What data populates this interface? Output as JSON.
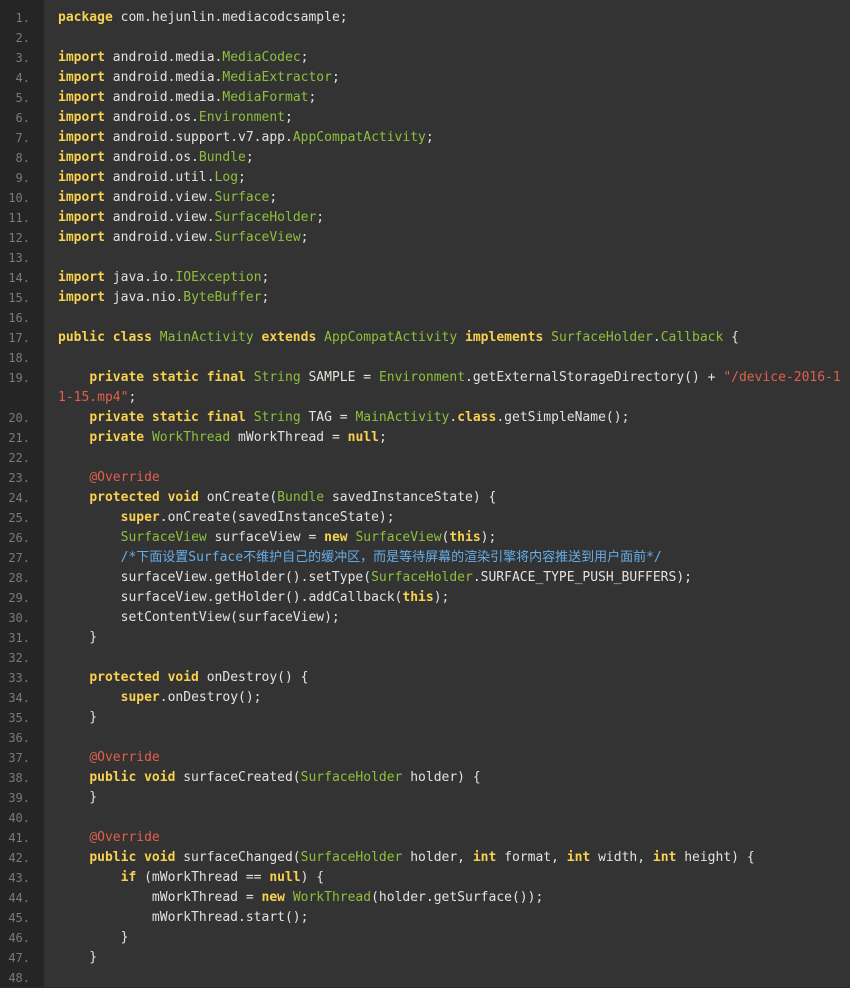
{
  "colors": {
    "background": "#333333",
    "gutter": "#252525",
    "keyword": "#f8d14e",
    "type": "#8ec03c",
    "annotation": "#e0604a",
    "comment": "#66aee8",
    "text": "#e6e1dc"
  },
  "lines": [
    {
      "n": "1.",
      "tokens": [
        [
          "k",
          "package"
        ],
        [
          "p",
          " com.hejunlin.mediacodcsample;"
        ]
      ]
    },
    {
      "n": "2.",
      "tokens": []
    },
    {
      "n": "3.",
      "tokens": [
        [
          "k",
          "import"
        ],
        [
          "p",
          " android.media."
        ],
        [
          "t",
          "MediaCodec"
        ],
        [
          "p",
          ";"
        ]
      ]
    },
    {
      "n": "4.",
      "tokens": [
        [
          "k",
          "import"
        ],
        [
          "p",
          " android.media."
        ],
        [
          "t",
          "MediaExtractor"
        ],
        [
          "p",
          ";"
        ]
      ]
    },
    {
      "n": "5.",
      "tokens": [
        [
          "k",
          "import"
        ],
        [
          "p",
          " android.media."
        ],
        [
          "t",
          "MediaFormat"
        ],
        [
          "p",
          ";"
        ]
      ]
    },
    {
      "n": "6.",
      "tokens": [
        [
          "k",
          "import"
        ],
        [
          "p",
          " android.os."
        ],
        [
          "t",
          "Environment"
        ],
        [
          "p",
          ";"
        ]
      ]
    },
    {
      "n": "7.",
      "tokens": [
        [
          "k",
          "import"
        ],
        [
          "p",
          " android.support.v7.app."
        ],
        [
          "t",
          "AppCompatActivity"
        ],
        [
          "p",
          ";"
        ]
      ]
    },
    {
      "n": "8.",
      "tokens": [
        [
          "k",
          "import"
        ],
        [
          "p",
          " android.os."
        ],
        [
          "t",
          "Bundle"
        ],
        [
          "p",
          ";"
        ]
      ]
    },
    {
      "n": "9.",
      "tokens": [
        [
          "k",
          "import"
        ],
        [
          "p",
          " android.util."
        ],
        [
          "t",
          "Log"
        ],
        [
          "p",
          ";"
        ]
      ]
    },
    {
      "n": "10.",
      "tokens": [
        [
          "k",
          "import"
        ],
        [
          "p",
          " android.view."
        ],
        [
          "t",
          "Surface"
        ],
        [
          "p",
          ";"
        ]
      ]
    },
    {
      "n": "11.",
      "tokens": [
        [
          "k",
          "import"
        ],
        [
          "p",
          " android.view."
        ],
        [
          "t",
          "SurfaceHolder"
        ],
        [
          "p",
          ";"
        ]
      ]
    },
    {
      "n": "12.",
      "tokens": [
        [
          "k",
          "import"
        ],
        [
          "p",
          " android.view."
        ],
        [
          "t",
          "SurfaceView"
        ],
        [
          "p",
          ";"
        ]
      ]
    },
    {
      "n": "13.",
      "tokens": []
    },
    {
      "n": "14.",
      "tokens": [
        [
          "k",
          "import"
        ],
        [
          "p",
          " java.io."
        ],
        [
          "t",
          "IOException"
        ],
        [
          "p",
          ";"
        ]
      ]
    },
    {
      "n": "15.",
      "tokens": [
        [
          "k",
          "import"
        ],
        [
          "p",
          " java.nio."
        ],
        [
          "t",
          "ByteBuffer"
        ],
        [
          "p",
          ";"
        ]
      ]
    },
    {
      "n": "16.",
      "tokens": []
    },
    {
      "n": "17.",
      "tokens": [
        [
          "k",
          "public class"
        ],
        [
          "p",
          " "
        ],
        [
          "t",
          "MainActivity"
        ],
        [
          "p",
          " "
        ],
        [
          "k",
          "extends"
        ],
        [
          "p",
          " "
        ],
        [
          "t",
          "AppCompatActivity"
        ],
        [
          "p",
          " "
        ],
        [
          "k",
          "implements"
        ],
        [
          "p",
          " "
        ],
        [
          "t",
          "SurfaceHolder"
        ],
        [
          "p",
          "."
        ],
        [
          "t",
          "Callback"
        ],
        [
          "p",
          " {"
        ]
      ]
    },
    {
      "n": "18.",
      "tokens": []
    },
    {
      "n": "19.",
      "wrap": true,
      "tokens": [
        [
          "p",
          "    "
        ],
        [
          "k",
          "private static final"
        ],
        [
          "p",
          " "
        ],
        [
          "t",
          "String"
        ],
        [
          "p",
          " SAMPLE = "
        ],
        [
          "t",
          "Environment"
        ],
        [
          "p",
          ".getExternalStorageDirectory() + "
        ],
        [
          "s",
          "\"/device-2016-1"
        ]
      ],
      "tokens2": [
        [
          "s",
          "1-15.mp4\""
        ],
        [
          "p",
          ";"
        ]
      ]
    },
    {
      "n": "20.",
      "tokens": [
        [
          "p",
          "    "
        ],
        [
          "k",
          "private static final"
        ],
        [
          "p",
          " "
        ],
        [
          "t",
          "String"
        ],
        [
          "p",
          " TAG = "
        ],
        [
          "t",
          "MainActivity"
        ],
        [
          "p",
          "."
        ],
        [
          "k",
          "class"
        ],
        [
          "p",
          ".getSimpleName();"
        ]
      ]
    },
    {
      "n": "21.",
      "tokens": [
        [
          "p",
          "    "
        ],
        [
          "k",
          "private"
        ],
        [
          "p",
          " "
        ],
        [
          "t",
          "WorkThread"
        ],
        [
          "p",
          " mWorkThread = "
        ],
        [
          "k",
          "null"
        ],
        [
          "p",
          ";"
        ]
      ]
    },
    {
      "n": "22.",
      "tokens": []
    },
    {
      "n": "23.",
      "tokens": [
        [
          "p",
          "    "
        ],
        [
          "a",
          "@Override"
        ]
      ]
    },
    {
      "n": "24.",
      "tokens": [
        [
          "p",
          "    "
        ],
        [
          "k",
          "protected void"
        ],
        [
          "p",
          " onCreate("
        ],
        [
          "t",
          "Bundle"
        ],
        [
          "p",
          " savedInstanceState) {"
        ]
      ]
    },
    {
      "n": "25.",
      "tokens": [
        [
          "p",
          "        "
        ],
        [
          "k",
          "super"
        ],
        [
          "p",
          ".onCreate(savedInstanceState);"
        ]
      ]
    },
    {
      "n": "26.",
      "tokens": [
        [
          "p",
          "        "
        ],
        [
          "t",
          "SurfaceView"
        ],
        [
          "p",
          " surfaceView = "
        ],
        [
          "k",
          "new"
        ],
        [
          "p",
          " "
        ],
        [
          "t",
          "SurfaceView"
        ],
        [
          "p",
          "("
        ],
        [
          "k",
          "this"
        ],
        [
          "p",
          ");"
        ]
      ]
    },
    {
      "n": "27.",
      "tokens": [
        [
          "p",
          "        "
        ],
        [
          "c",
          "/*下面设置Surface不维护自己的缓冲区，而是等待屏幕的渲染引擎将内容推送到用户面前*/"
        ]
      ]
    },
    {
      "n": "28.",
      "tokens": [
        [
          "p",
          "        surfaceView.getHolder().setType("
        ],
        [
          "t",
          "SurfaceHolder"
        ],
        [
          "p",
          ".SURFACE_TYPE_PUSH_BUFFERS);"
        ]
      ]
    },
    {
      "n": "29.",
      "tokens": [
        [
          "p",
          "        surfaceView.getHolder().addCallback("
        ],
        [
          "k",
          "this"
        ],
        [
          "p",
          ");"
        ]
      ]
    },
    {
      "n": "30.",
      "tokens": [
        [
          "p",
          "        setContentView(surfaceView);"
        ]
      ]
    },
    {
      "n": "31.",
      "tokens": [
        [
          "p",
          "    }"
        ]
      ]
    },
    {
      "n": "32.",
      "tokens": []
    },
    {
      "n": "33.",
      "tokens": [
        [
          "p",
          "    "
        ],
        [
          "k",
          "protected void"
        ],
        [
          "p",
          " onDestroy() {"
        ]
      ]
    },
    {
      "n": "34.",
      "tokens": [
        [
          "p",
          "        "
        ],
        [
          "k",
          "super"
        ],
        [
          "p",
          ".onDestroy();"
        ]
      ]
    },
    {
      "n": "35.",
      "tokens": [
        [
          "p",
          "    }"
        ]
      ]
    },
    {
      "n": "36.",
      "tokens": []
    },
    {
      "n": "37.",
      "tokens": [
        [
          "p",
          "    "
        ],
        [
          "a",
          "@Override"
        ]
      ]
    },
    {
      "n": "38.",
      "tokens": [
        [
          "p",
          "    "
        ],
        [
          "k",
          "public void"
        ],
        [
          "p",
          " surfaceCreated("
        ],
        [
          "t",
          "SurfaceHolder"
        ],
        [
          "p",
          " holder) {"
        ]
      ]
    },
    {
      "n": "39.",
      "tokens": [
        [
          "p",
          "    }"
        ]
      ]
    },
    {
      "n": "40.",
      "tokens": []
    },
    {
      "n": "41.",
      "tokens": [
        [
          "p",
          "    "
        ],
        [
          "a",
          "@Override"
        ]
      ]
    },
    {
      "n": "42.",
      "tokens": [
        [
          "p",
          "    "
        ],
        [
          "k",
          "public void"
        ],
        [
          "p",
          " surfaceChanged("
        ],
        [
          "t",
          "SurfaceHolder"
        ],
        [
          "p",
          " holder, "
        ],
        [
          "k",
          "int"
        ],
        [
          "p",
          " format, "
        ],
        [
          "k",
          "int"
        ],
        [
          "p",
          " width, "
        ],
        [
          "k",
          "int"
        ],
        [
          "p",
          " height) {"
        ]
      ]
    },
    {
      "n": "43.",
      "tokens": [
        [
          "p",
          "        "
        ],
        [
          "k",
          "if"
        ],
        [
          "p",
          " (mWorkThread == "
        ],
        [
          "k",
          "null"
        ],
        [
          "p",
          ") {"
        ]
      ]
    },
    {
      "n": "44.",
      "tokens": [
        [
          "p",
          "            mWorkThread = "
        ],
        [
          "k",
          "new"
        ],
        [
          "p",
          " "
        ],
        [
          "t",
          "WorkThread"
        ],
        [
          "p",
          "(holder.getSurface());"
        ]
      ]
    },
    {
      "n": "45.",
      "tokens": [
        [
          "p",
          "            mWorkThread.start();"
        ]
      ]
    },
    {
      "n": "46.",
      "tokens": [
        [
          "p",
          "        }"
        ]
      ]
    },
    {
      "n": "47.",
      "tokens": [
        [
          "p",
          "    }"
        ]
      ]
    },
    {
      "n": "48.",
      "tokens": []
    }
  ]
}
